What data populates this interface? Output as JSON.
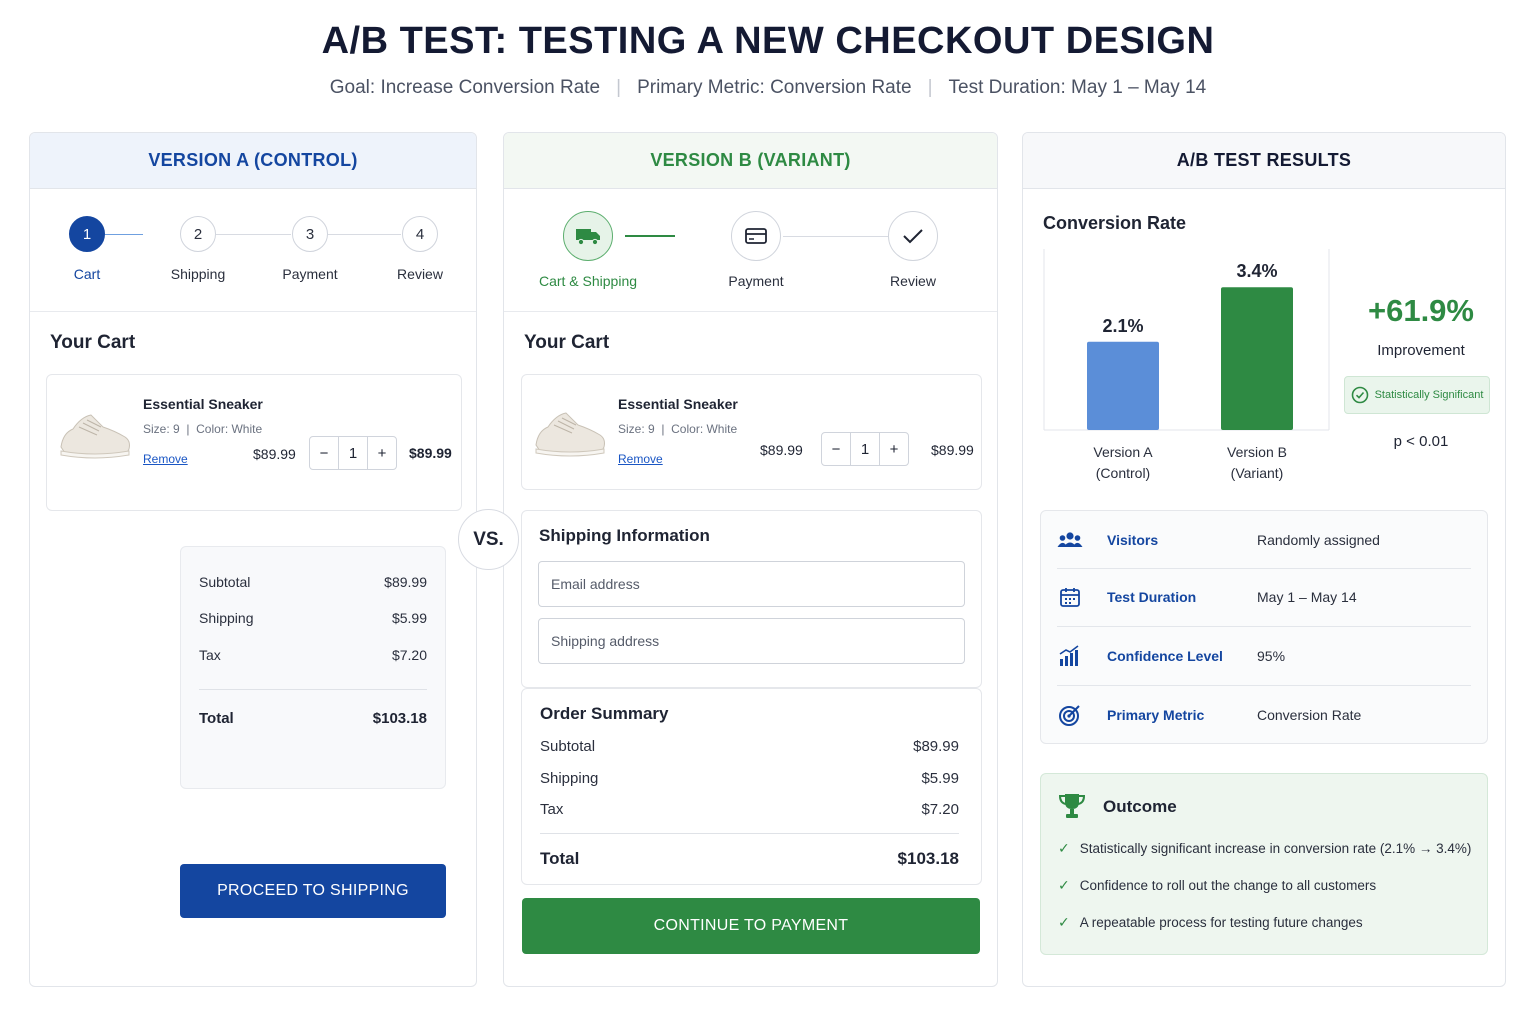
{
  "header": {
    "title": "A/B TEST: TESTING A NEW CHECKOUT DESIGN",
    "goal": "Goal: Increase Conversion Rate",
    "metric": "Primary Metric: Conversion Rate",
    "duration": "Test Duration: May 1 – May 14"
  },
  "versionA": {
    "title": "VERSION A (CONTROL)",
    "steps": [
      {
        "num": "1",
        "label": "Cart"
      },
      {
        "num": "2",
        "label": "Shipping"
      },
      {
        "num": "3",
        "label": "Payment"
      },
      {
        "num": "4",
        "label": "Review"
      }
    ],
    "cart_title": "Your Cart",
    "product": {
      "name": "Essential Sneaker",
      "meta": "Size: 9  |  Color: White",
      "remove": "Remove",
      "unit_price": "$89.99",
      "qty": "1",
      "line_total": "$89.99",
      "minus": "−",
      "plus": "+"
    },
    "summary": {
      "subtotal_label": "Subtotal",
      "subtotal": "$89.99",
      "shipping_label": "Shipping",
      "shipping": "$5.99",
      "tax_label": "Tax",
      "tax": "$7.20",
      "total_label": "Total",
      "total": "$103.18"
    },
    "button": "PROCEED TO SHIPPING"
  },
  "vs": "VS.",
  "versionB": {
    "title": "VERSION B (VARIANT)",
    "steps": [
      {
        "label": "Cart & Shipping",
        "icon": "truck-icon"
      },
      {
        "label": "Payment",
        "icon": "card-icon"
      },
      {
        "label": "Review",
        "icon": "check-icon"
      }
    ],
    "cart_title": "Your Cart",
    "product": {
      "name": "Essential Sneaker",
      "meta": "Size: 9  |  Color: White",
      "remove": "Remove",
      "unit_price": "$89.99",
      "qty": "1",
      "line_total": "$89.99",
      "minus": "−",
      "plus": "+"
    },
    "shipping_title": "Shipping Information",
    "email_placeholder": "Email address",
    "address_placeholder": "Shipping address",
    "order_summary_title": "Order Summary",
    "summary": {
      "subtotal_label": "Subtotal",
      "subtotal": "$89.99",
      "shipping_label": "Shipping",
      "shipping": "$5.99",
      "tax_label": "Tax",
      "tax": "$7.20",
      "total_label": "Total",
      "total": "$103.18"
    },
    "button": "CONTINUE TO PAYMENT"
  },
  "results": {
    "title": "A/B TEST RESULTS",
    "chart_title": "Conversion Rate",
    "improvement": "+61.9%",
    "improvement_label": "Improvement",
    "significance": "Statistically Significant",
    "p_value": "p < 0.01",
    "meta": [
      {
        "label": "Visitors",
        "value": "Randomly assigned",
        "icon": "users-icon"
      },
      {
        "label": "Test Duration",
        "value": "May 1 – May 14",
        "icon": "calendar-icon"
      },
      {
        "label": "Confidence Level",
        "value": "95%",
        "icon": "bar-trend-icon"
      },
      {
        "label": "Primary Metric",
        "value": "Conversion Rate",
        "icon": "target-icon"
      }
    ],
    "outcome_title": "Outcome",
    "outcomes": [
      "Statistically significant increase in conversion rate (2.1% → 3.4%)",
      "Confidence to roll out the change to all customers",
      "A repeatable process for testing future changes"
    ]
  },
  "chart_data": {
    "type": "bar",
    "title": "Conversion Rate",
    "categories": [
      "Version A\n(Control)",
      "Version B\n(Variant)"
    ],
    "category_lines": [
      [
        "Version A",
        "(Control)"
      ],
      [
        "Version B",
        "(Variant)"
      ]
    ],
    "values": [
      2.1,
      3.4
    ],
    "value_labels": [
      "2.1%",
      "3.4%"
    ],
    "colors": [
      "#5b8ed8",
      "#2e8a43"
    ],
    "ylim": [
      0,
      3.5
    ],
    "grid": false,
    "xlabel": "",
    "ylabel": ""
  },
  "colors": {
    "blue": "#1446a0",
    "green": "#2e8a43"
  }
}
